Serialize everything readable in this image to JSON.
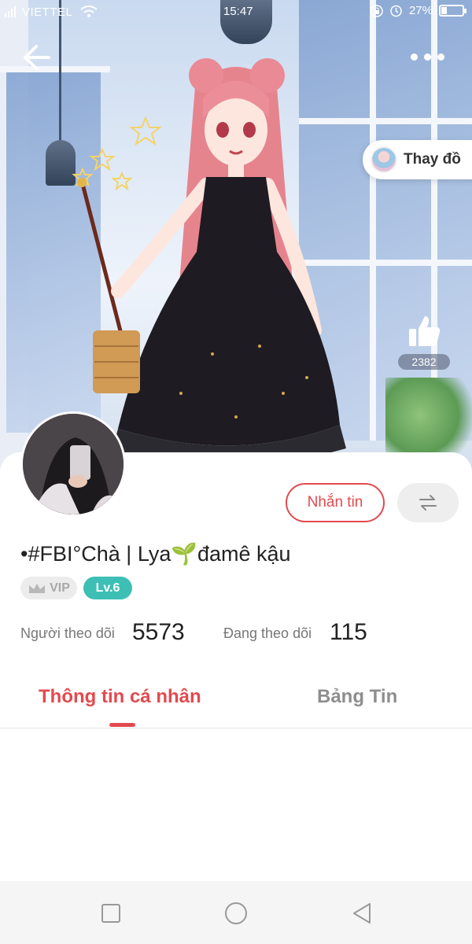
{
  "status_bar": {
    "carrier": "VIETTEL",
    "time": "15:47",
    "battery": "27%",
    "battery_level": 0.27,
    "icons": [
      "signal-icon",
      "wifi-icon",
      "lock-icon",
      "alarm-icon",
      "battery-icon"
    ]
  },
  "header": {
    "back_icon": "arrow-left-icon",
    "more_icon": "more-horizontal-icon"
  },
  "outfit_button": {
    "label": "Thay đồ"
  },
  "likes": {
    "count": "2382",
    "icon": "thumbs-up-icon"
  },
  "profile": {
    "username": "•#FBI°Chà | Lya🌱đamê kậu",
    "vip_label": "VIP",
    "level_label": "Lv.6",
    "message_button": "Nhắn tin",
    "switch_icon": "swap-arrows-icon",
    "followers_label": "Người theo dõi",
    "followers_count": "5573",
    "following_label": "Đang theo dõi",
    "following_count": "115"
  },
  "tabs": [
    {
      "label": "Thông tin cá nhân",
      "active": true
    },
    {
      "label": "Bảng Tin",
      "active": false
    }
  ],
  "nav_bar": {
    "icons": [
      "recent-apps-icon",
      "home-icon",
      "back-triangle-icon"
    ]
  },
  "colors": {
    "accent": "#e24a4f",
    "level_badge": "#3dbfb5",
    "vip_badge": "#ececec"
  }
}
